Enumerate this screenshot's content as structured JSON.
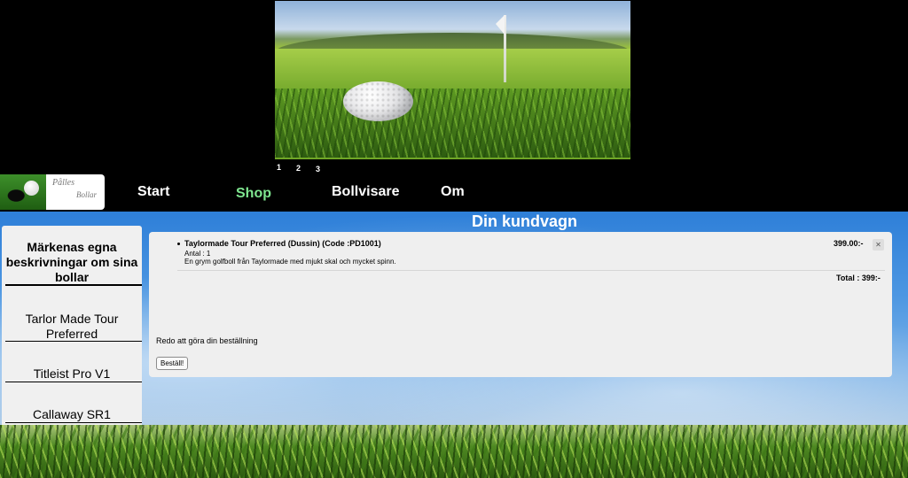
{
  "slider": {
    "pages": [
      "1",
      "2",
      "3"
    ]
  },
  "logo": {
    "line1": "Pålles",
    "line2": "Bollar"
  },
  "nav": {
    "items": [
      {
        "label": "Start",
        "active": false
      },
      {
        "label": "Shop",
        "active": true
      },
      {
        "label": "Bollvisare",
        "active": false
      },
      {
        "label": "Om",
        "active": false
      }
    ]
  },
  "page": {
    "heading": "Din kundvagn"
  },
  "sidebar": {
    "heading": "Märkenas egna beskrivningar om sina bollar",
    "items": [
      "Tarlor Made Tour Preferred",
      "Titleist Pro V1",
      "Callaway SR1"
    ]
  },
  "cart": {
    "item": {
      "title": "Taylormade Tour Preferred (Dussin) (Code :PD1001)",
      "quantity": "Antal : 1",
      "description": "En grym golfboll från Taylormade med mjukt skal och mycket spinn.",
      "price": "399.00:-",
      "remove_label": "✕"
    },
    "total": "Total : 399:-",
    "ready_text": "Redo att göra din beställning",
    "order_button": "Beställ!"
  },
  "colors": {
    "active_nav": "#7fe690",
    "header_bg": "#000000",
    "sky": "#4d97e2"
  }
}
